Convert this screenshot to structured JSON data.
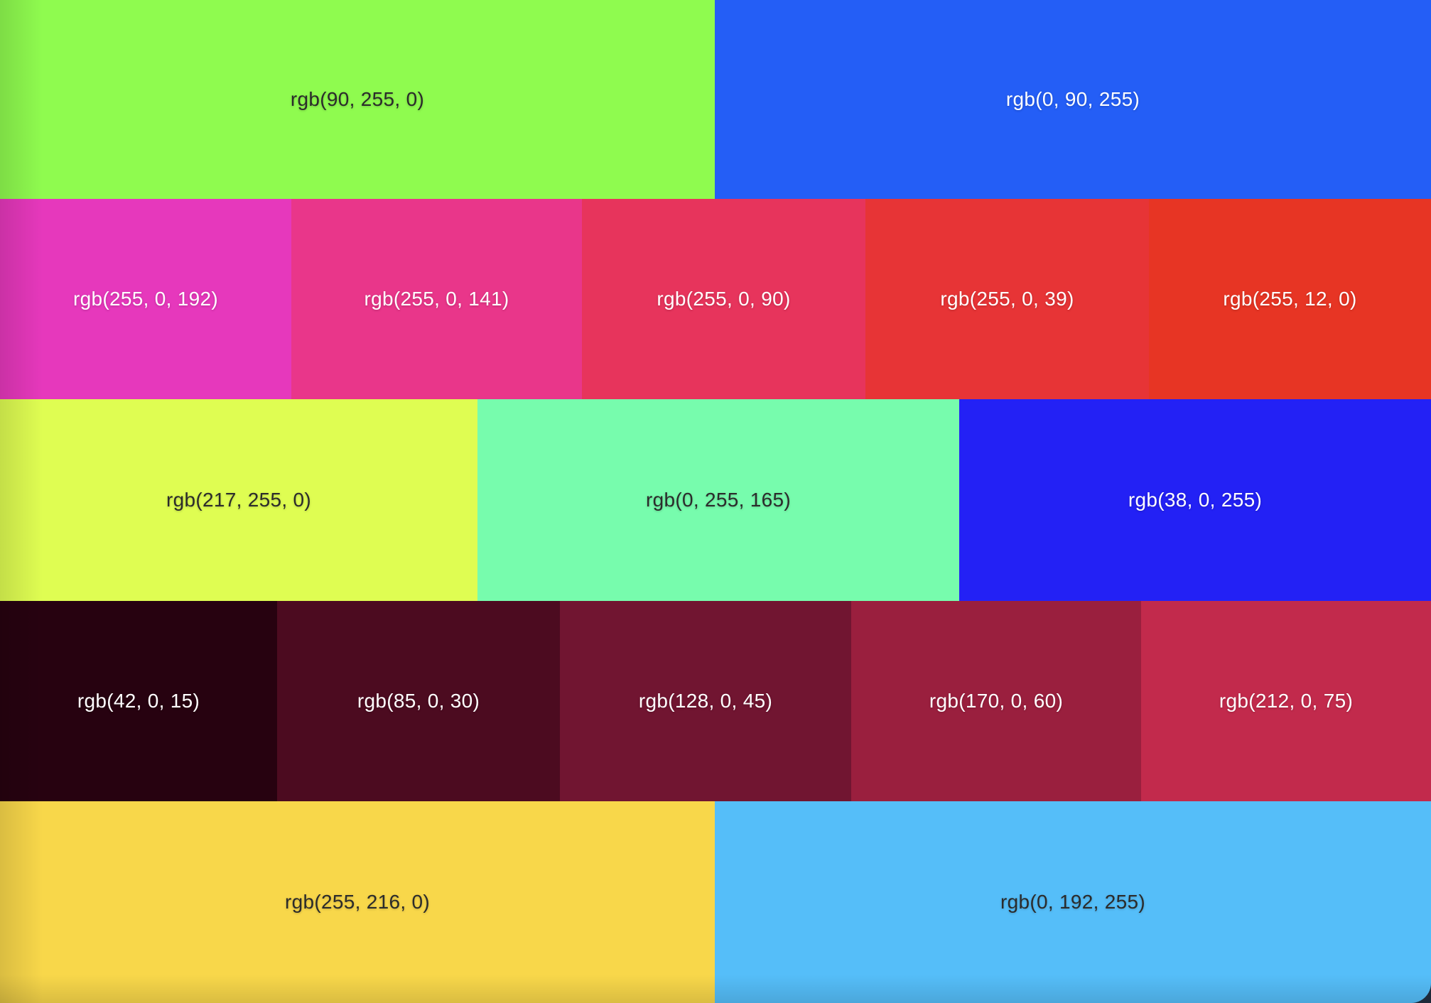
{
  "rows": [
    {
      "swatches": [
        {
          "label": "rgb(90, 255, 0)",
          "color": "#8ffb4f",
          "tone": "light"
        },
        {
          "label": "rgb(0, 90, 255)",
          "color": "#245ef6",
          "tone": "dark"
        }
      ]
    },
    {
      "swatches": [
        {
          "label": "rgb(255, 0, 192)",
          "color": "#e638bc",
          "tone": "dark"
        },
        {
          "label": "rgb(255, 0, 141)",
          "color": "#e9368a",
          "tone": "dark"
        },
        {
          "label": "rgb(255, 0, 90)",
          "color": "#e7345c",
          "tone": "dark"
        },
        {
          "label": "rgb(255, 0, 39)",
          "color": "#e73436",
          "tone": "dark"
        },
        {
          "label": "rgb(255, 12, 0)",
          "color": "#e73524",
          "tone": "dark"
        }
      ]
    },
    {
      "swatches": [
        {
          "label": "rgb(217, 255, 0)",
          "color": "#dffd52",
          "tone": "light"
        },
        {
          "label": "rgb(0, 255, 165)",
          "color": "#77fcad",
          "tone": "light"
        },
        {
          "label": "rgb(38, 0, 255)",
          "color": "#2321f5",
          "tone": "dark"
        }
      ]
    },
    {
      "swatches": [
        {
          "label": "rgb(42, 0, 15)",
          "color": "#270210",
          "tone": "dark"
        },
        {
          "label": "rgb(85, 0, 30)",
          "color": "#4c0b20",
          "tone": "dark"
        },
        {
          "label": "rgb(128, 0, 45)",
          "color": "#711531",
          "tone": "dark"
        },
        {
          "label": "rgb(170, 0, 60)",
          "color": "#9a1f3e",
          "tone": "dark"
        },
        {
          "label": "rgb(212, 0, 75)",
          "color": "#c22a4c",
          "tone": "dark"
        }
      ]
    },
    {
      "swatches": [
        {
          "label": "rgb(255, 216, 0)",
          "color": "#f8d74a",
          "tone": "light"
        },
        {
          "label": "rgb(0, 192, 255)",
          "color": "#55bef9",
          "tone": "light"
        }
      ]
    }
  ]
}
